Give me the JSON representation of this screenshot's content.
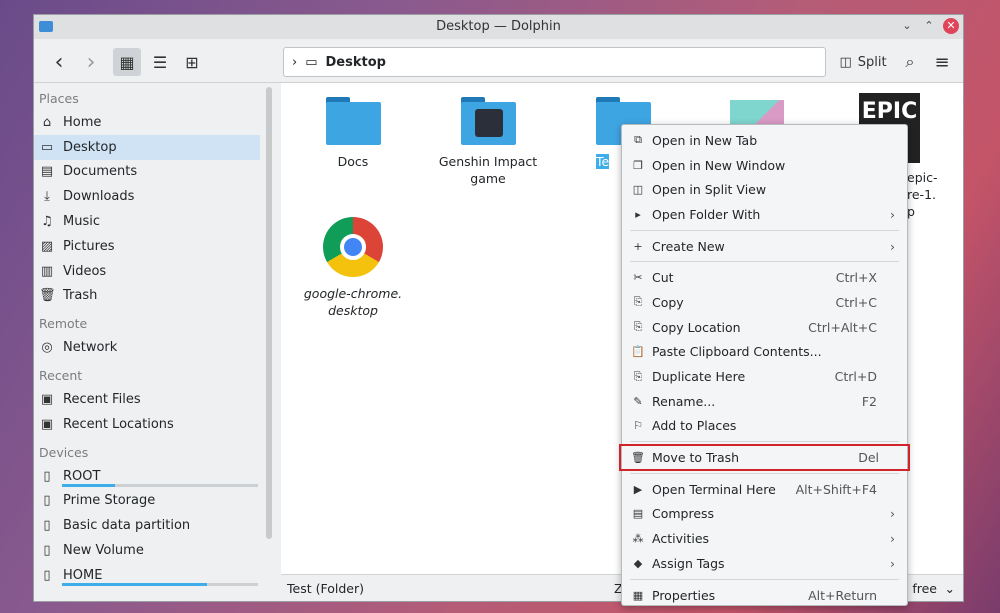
{
  "window": {
    "title": "Desktop — Dolphin"
  },
  "toolbar": {
    "back": "‹",
    "forward": "›",
    "breadcrumb": "Desktop",
    "split": "Split"
  },
  "sidebar": {
    "sections": [
      {
        "title": "Places",
        "items": [
          {
            "label": "Home",
            "icon": "home-icon"
          },
          {
            "label": "Desktop",
            "icon": "desktop-icon",
            "selected": true
          },
          {
            "label": "Documents",
            "icon": "documents-icon"
          },
          {
            "label": "Downloads",
            "icon": "downloads-icon"
          },
          {
            "label": "Music",
            "icon": "music-icon"
          },
          {
            "label": "Pictures",
            "icon": "pictures-icon"
          },
          {
            "label": "Videos",
            "icon": "videos-icon"
          },
          {
            "label": "Trash",
            "icon": "trash-icon"
          }
        ]
      },
      {
        "title": "Remote",
        "items": [
          {
            "label": "Network",
            "icon": "network-icon"
          }
        ]
      },
      {
        "title": "Recent",
        "items": [
          {
            "label": "Recent Files",
            "icon": "recent-files-icon"
          },
          {
            "label": "Recent Locations",
            "icon": "recent-locations-icon"
          }
        ]
      },
      {
        "title": "Devices",
        "items": [
          {
            "label": "ROOT",
            "icon": "drive-icon",
            "usage": 0.27
          },
          {
            "label": "Prime Storage",
            "icon": "drive-icon"
          },
          {
            "label": "Basic data partition",
            "icon": "drive-icon"
          },
          {
            "label": "New Volume",
            "icon": "drive-icon"
          },
          {
            "label": "HOME",
            "icon": "drive-icon",
            "usage": 0.74
          }
        ]
      }
    ]
  },
  "files": [
    {
      "name": "Docs"
    },
    {
      "name": "Genshin Impact game"
    },
    {
      "name": "Te"
    },
    {
      "name": "epic-\nre-1.\np"
    },
    {
      "name": "google-chrome.\ndesktop"
    }
  ],
  "status": {
    "left": "Test (Folder)",
    "mid": "Z",
    "right": "free"
  },
  "menu": {
    "items": [
      {
        "label": "Open in New Tab",
        "icon": "⧉"
      },
      {
        "label": "Open in New Window",
        "icon": "❐"
      },
      {
        "label": "Open in Split View",
        "icon": "◫"
      },
      {
        "label": "Open Folder With",
        "icon": "▸",
        "submenu": true
      },
      {
        "sep": true
      },
      {
        "label": "Create New",
        "icon": "+",
        "submenu": true
      },
      {
        "sep": true
      },
      {
        "label": "Cut",
        "icon": "✂",
        "shortcut": "Ctrl+X"
      },
      {
        "label": "Copy",
        "icon": "⎘",
        "shortcut": "Ctrl+C"
      },
      {
        "label": "Copy Location",
        "icon": "⎘",
        "shortcut": "Ctrl+Alt+C"
      },
      {
        "label": "Paste Clipboard Contents...",
        "icon": "📋"
      },
      {
        "label": "Duplicate Here",
        "icon": "⎘",
        "shortcut": "Ctrl+D"
      },
      {
        "label": "Rename...",
        "icon": "✎",
        "shortcut": "F2"
      },
      {
        "label": "Add to Places",
        "icon": "⚐"
      },
      {
        "sep": true
      },
      {
        "label": "Move to Trash",
        "icon": "🗑",
        "shortcut": "Del",
        "highlight": true
      },
      {
        "sep": true
      },
      {
        "label": "Open Terminal Here",
        "icon": "▶",
        "shortcut": "Alt+Shift+F4"
      },
      {
        "label": "Compress",
        "icon": "▤",
        "submenu": true
      },
      {
        "label": "Activities",
        "icon": "⁂",
        "submenu": true
      },
      {
        "label": "Assign Tags",
        "icon": "◆",
        "submenu": true
      },
      {
        "sep": true
      },
      {
        "label": "Properties",
        "icon": "▦",
        "shortcut": "Alt+Return"
      }
    ]
  },
  "colors": {
    "accent": "#3daee9",
    "highlight_border": "#d0232a"
  }
}
